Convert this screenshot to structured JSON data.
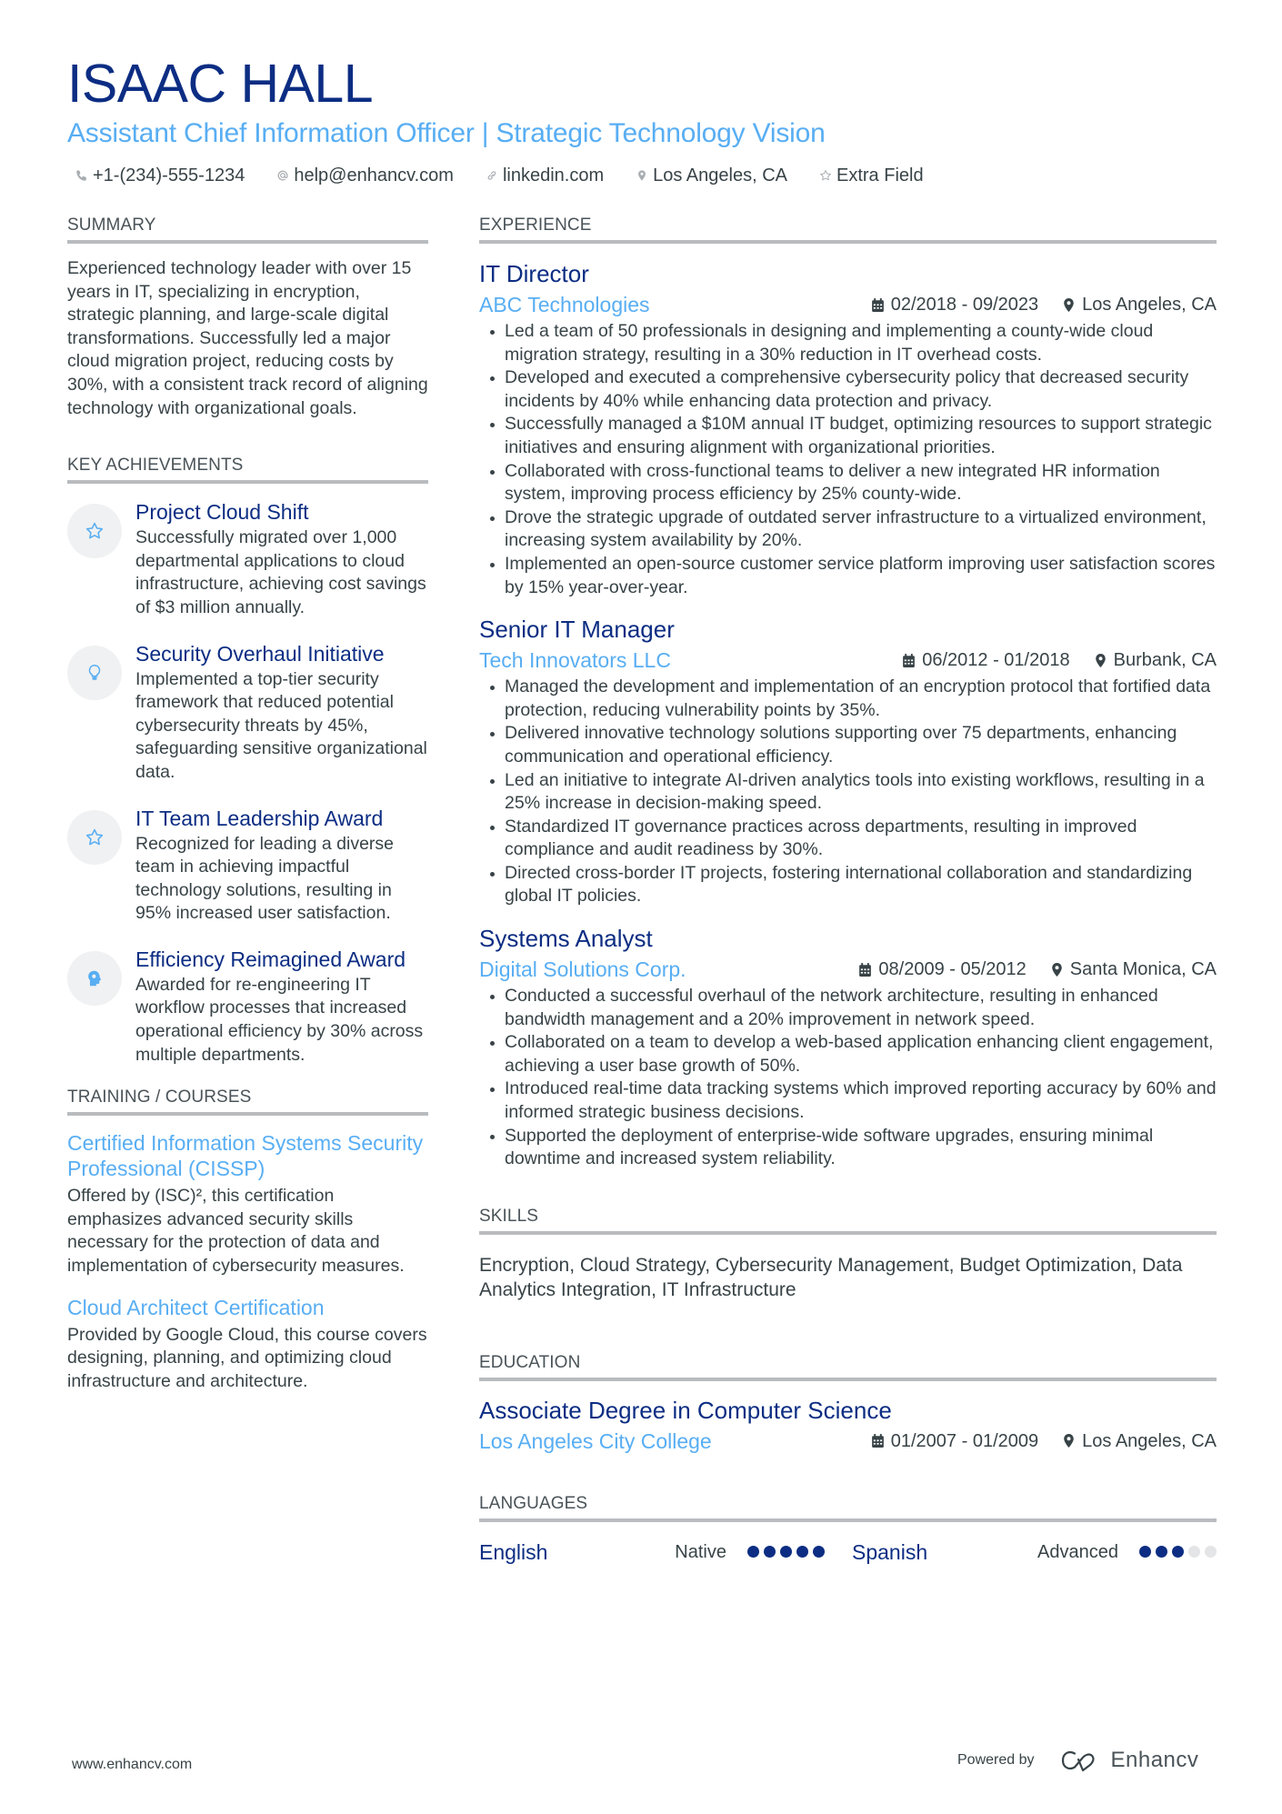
{
  "header": {
    "name": "ISAAC HALL",
    "headline": "Assistant Chief Information Officer | Strategic Technology Vision",
    "contacts": [
      {
        "icon": "phone-icon",
        "text": "+1-(234)-555-1234"
      },
      {
        "icon": "at-icon",
        "text": "help@enhancv.com"
      },
      {
        "icon": "link-icon",
        "text": "linkedin.com"
      },
      {
        "icon": "location-pin-icon",
        "text": "Los Angeles, CA"
      },
      {
        "icon": "star-icon",
        "text": "Extra Field"
      }
    ]
  },
  "summary": {
    "title": "SUMMARY",
    "text": "Experienced technology leader with over 15 years in IT, specializing in encryption, strategic planning, and large-scale digital transformations. Successfully led a major cloud migration project, reducing costs by 30%, with a consistent track record of aligning technology with organizational goals."
  },
  "achievements": {
    "title": "KEY ACHIEVEMENTS",
    "items": [
      {
        "icon": "star-icon",
        "title": "Project Cloud Shift",
        "desc": "Successfully migrated over 1,000 departmental applications to cloud infrastructure, achieving cost savings of $3 million annually."
      },
      {
        "icon": "lightbulb-icon",
        "title": "Security Overhaul Initiative",
        "desc": "Implemented a top-tier security framework that reduced potential cybersecurity threats by 45%, safeguarding sensitive organizational data."
      },
      {
        "icon": "star-icon",
        "title": "IT Team Leadership Award",
        "desc": "Recognized for leading a diverse team in achieving impactful technology solutions, resulting in 95% increased user satisfaction."
      },
      {
        "icon": "head-brain-icon",
        "title": "Efficiency Reimagined Award",
        "desc": "Awarded for re-engineering IT workflow processes that increased operational efficiency by 30% across multiple departments."
      }
    ]
  },
  "training": {
    "title": "TRAINING / COURSES",
    "items": [
      {
        "title": "Certified Information Systems Security Professional (CISSP)",
        "desc": "Offered by (ISC)², this certification emphasizes advanced security skills necessary for the protection of data and implementation of cybersecurity measures."
      },
      {
        "title": "Cloud Architect Certification",
        "desc": "Provided by Google Cloud, this course covers designing, planning, and optimizing cloud infrastructure and architecture."
      }
    ]
  },
  "experience": {
    "title": "EXPERIENCE",
    "jobs": [
      {
        "title": "IT Director",
        "company": "ABC Technologies",
        "dates": "02/2018 - 09/2023",
        "location": "Los Angeles, CA",
        "bullets": [
          "Led a team of 50 professionals in designing and implementing a county-wide cloud migration strategy, resulting in a 30% reduction in IT overhead costs.",
          "Developed and executed a comprehensive cybersecurity policy that decreased security incidents by 40% while enhancing data protection and privacy.",
          "Successfully managed a $10M annual IT budget, optimizing resources to support strategic initiatives and ensuring alignment with organizational priorities.",
          "Collaborated with cross-functional teams to deliver a new integrated HR information system, improving process efficiency by 25% county-wide.",
          "Drove the strategic upgrade of outdated server infrastructure to a virtualized environment, increasing system availability by 20%.",
          "Implemented an open-source customer service platform improving user satisfaction scores by 15% year-over-year."
        ]
      },
      {
        "title": "Senior IT Manager",
        "company": "Tech Innovators LLC",
        "dates": "06/2012 - 01/2018",
        "location": "Burbank, CA",
        "bullets": [
          "Managed the development and implementation of an encryption protocol that fortified data protection, reducing vulnerability points by 35%.",
          "Delivered innovative technology solutions supporting over 75 departments, enhancing communication and operational efficiency.",
          "Led an initiative to integrate AI-driven analytics tools into existing workflows, resulting in a 25% increase in decision-making speed.",
          "Standardized IT governance practices across departments, resulting in improved compliance and audit readiness by 30%.",
          "Directed cross-border IT projects, fostering international collaboration and standardizing global IT policies."
        ]
      },
      {
        "title": "Systems Analyst",
        "company": "Digital Solutions Corp.",
        "dates": "08/2009 - 05/2012",
        "location": "Santa Monica, CA",
        "bullets": [
          "Conducted a successful overhaul of the network architecture, resulting in enhanced bandwidth management and a 20% improvement in network speed.",
          "Collaborated on a team to develop a web-based application enhancing client engagement, achieving a user base growth of 50%.",
          "Introduced real-time data tracking systems which improved reporting accuracy by 60% and informed strategic business decisions.",
          "Supported the deployment of enterprise-wide software upgrades, ensuring minimal downtime and increased system reliability."
        ]
      }
    ]
  },
  "skills": {
    "title": "SKILLS",
    "text": "Encryption, Cloud Strategy, Cybersecurity Management, Budget Optimization, Data Analytics Integration, IT Infrastructure"
  },
  "education": {
    "title": "EDUCATION",
    "items": [
      {
        "degree": "Associate Degree in Computer Science",
        "school": "Los Angeles City College",
        "dates": "01/2007 - 01/2009",
        "location": "Los Angeles, CA"
      }
    ]
  },
  "languages": {
    "title": "LANGUAGES",
    "items": [
      {
        "name": "English",
        "level": "Native",
        "rating": 5,
        "max": 5
      },
      {
        "name": "Spanish",
        "level": "Advanced",
        "rating": 3,
        "max": 5
      }
    ]
  },
  "footer": {
    "website": "www.enhancv.com",
    "powered_by": "Powered by",
    "brand": "Enhancv"
  },
  "colors": {
    "name": "#0c2d83",
    "accent": "#58aef3",
    "text": "#384347",
    "rule": "#b9bcbf",
    "dot_off": "#e3e5e7"
  }
}
